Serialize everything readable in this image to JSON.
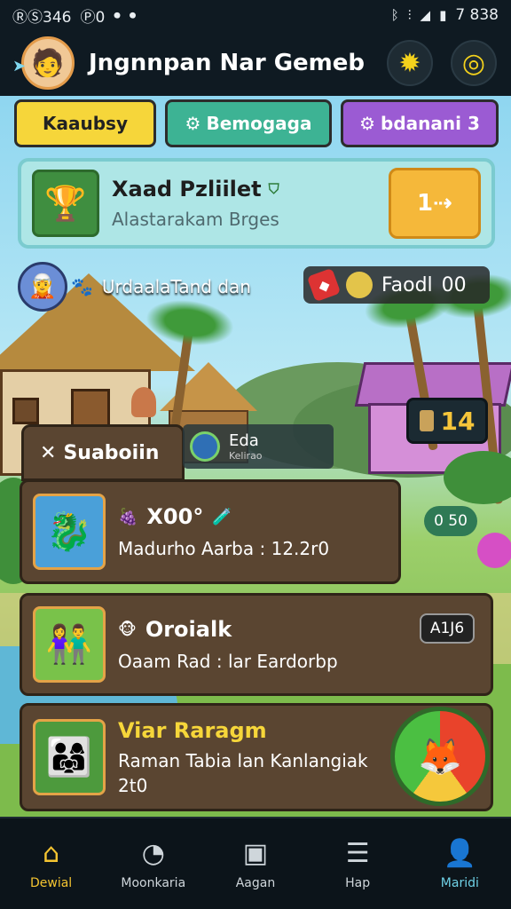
{
  "status_bar": {
    "left_text": "ⓇⓈ346",
    "left_extra": "Ⓟ0",
    "time": "7 838"
  },
  "header": {
    "title": "Jngnnpan Nar Gemeb",
    "avatar_icon": "explorer-avatar",
    "settings_icon": "sun-gear-icon",
    "notification_icon": "target-alert-icon"
  },
  "tabs": [
    {
      "label": "Kaaubsy"
    },
    {
      "label": "Bemogaga"
    },
    {
      "label": "bdanani 3"
    }
  ],
  "featured": {
    "title": "Xaad Pzliilet",
    "subtitle": "Alastarakam Brges",
    "button_label": "1⇢"
  },
  "player": {
    "name": "UrdaalaTand dan"
  },
  "food": {
    "label": "Faodl",
    "value": "00"
  },
  "score_box": {
    "value": "14"
  },
  "section": {
    "title": "Suaboiin",
    "eda_label": "Eda",
    "eda_sub": "Kelirao"
  },
  "cards": [
    {
      "title": "X00°",
      "subtitle": "Madurho Aarba : 12.2r0",
      "badge": "0 50"
    },
    {
      "title": "Oroialk",
      "subtitle": "Oaam Rad : lar Eardorbp",
      "badge": "A1J6"
    },
    {
      "title": "Viar Raragm",
      "subtitle": "Raman Tabia lan Kanlangiak",
      "extra": "2t0"
    }
  ],
  "bottom_nav": [
    {
      "label": "Dewial",
      "icon": "home-icon"
    },
    {
      "label": "Moonkaria",
      "icon": "gauge-icon"
    },
    {
      "label": "Aagan",
      "icon": "edit-square-icon"
    },
    {
      "label": "Hap",
      "icon": "list-badge-icon"
    },
    {
      "label": "Maridi",
      "icon": "person-icon"
    }
  ],
  "colors": {
    "accent_yellow": "#f6d63a",
    "accent_teal": "#3db394",
    "accent_purple": "#9b5bd3",
    "card_brown": "#5a4531"
  }
}
